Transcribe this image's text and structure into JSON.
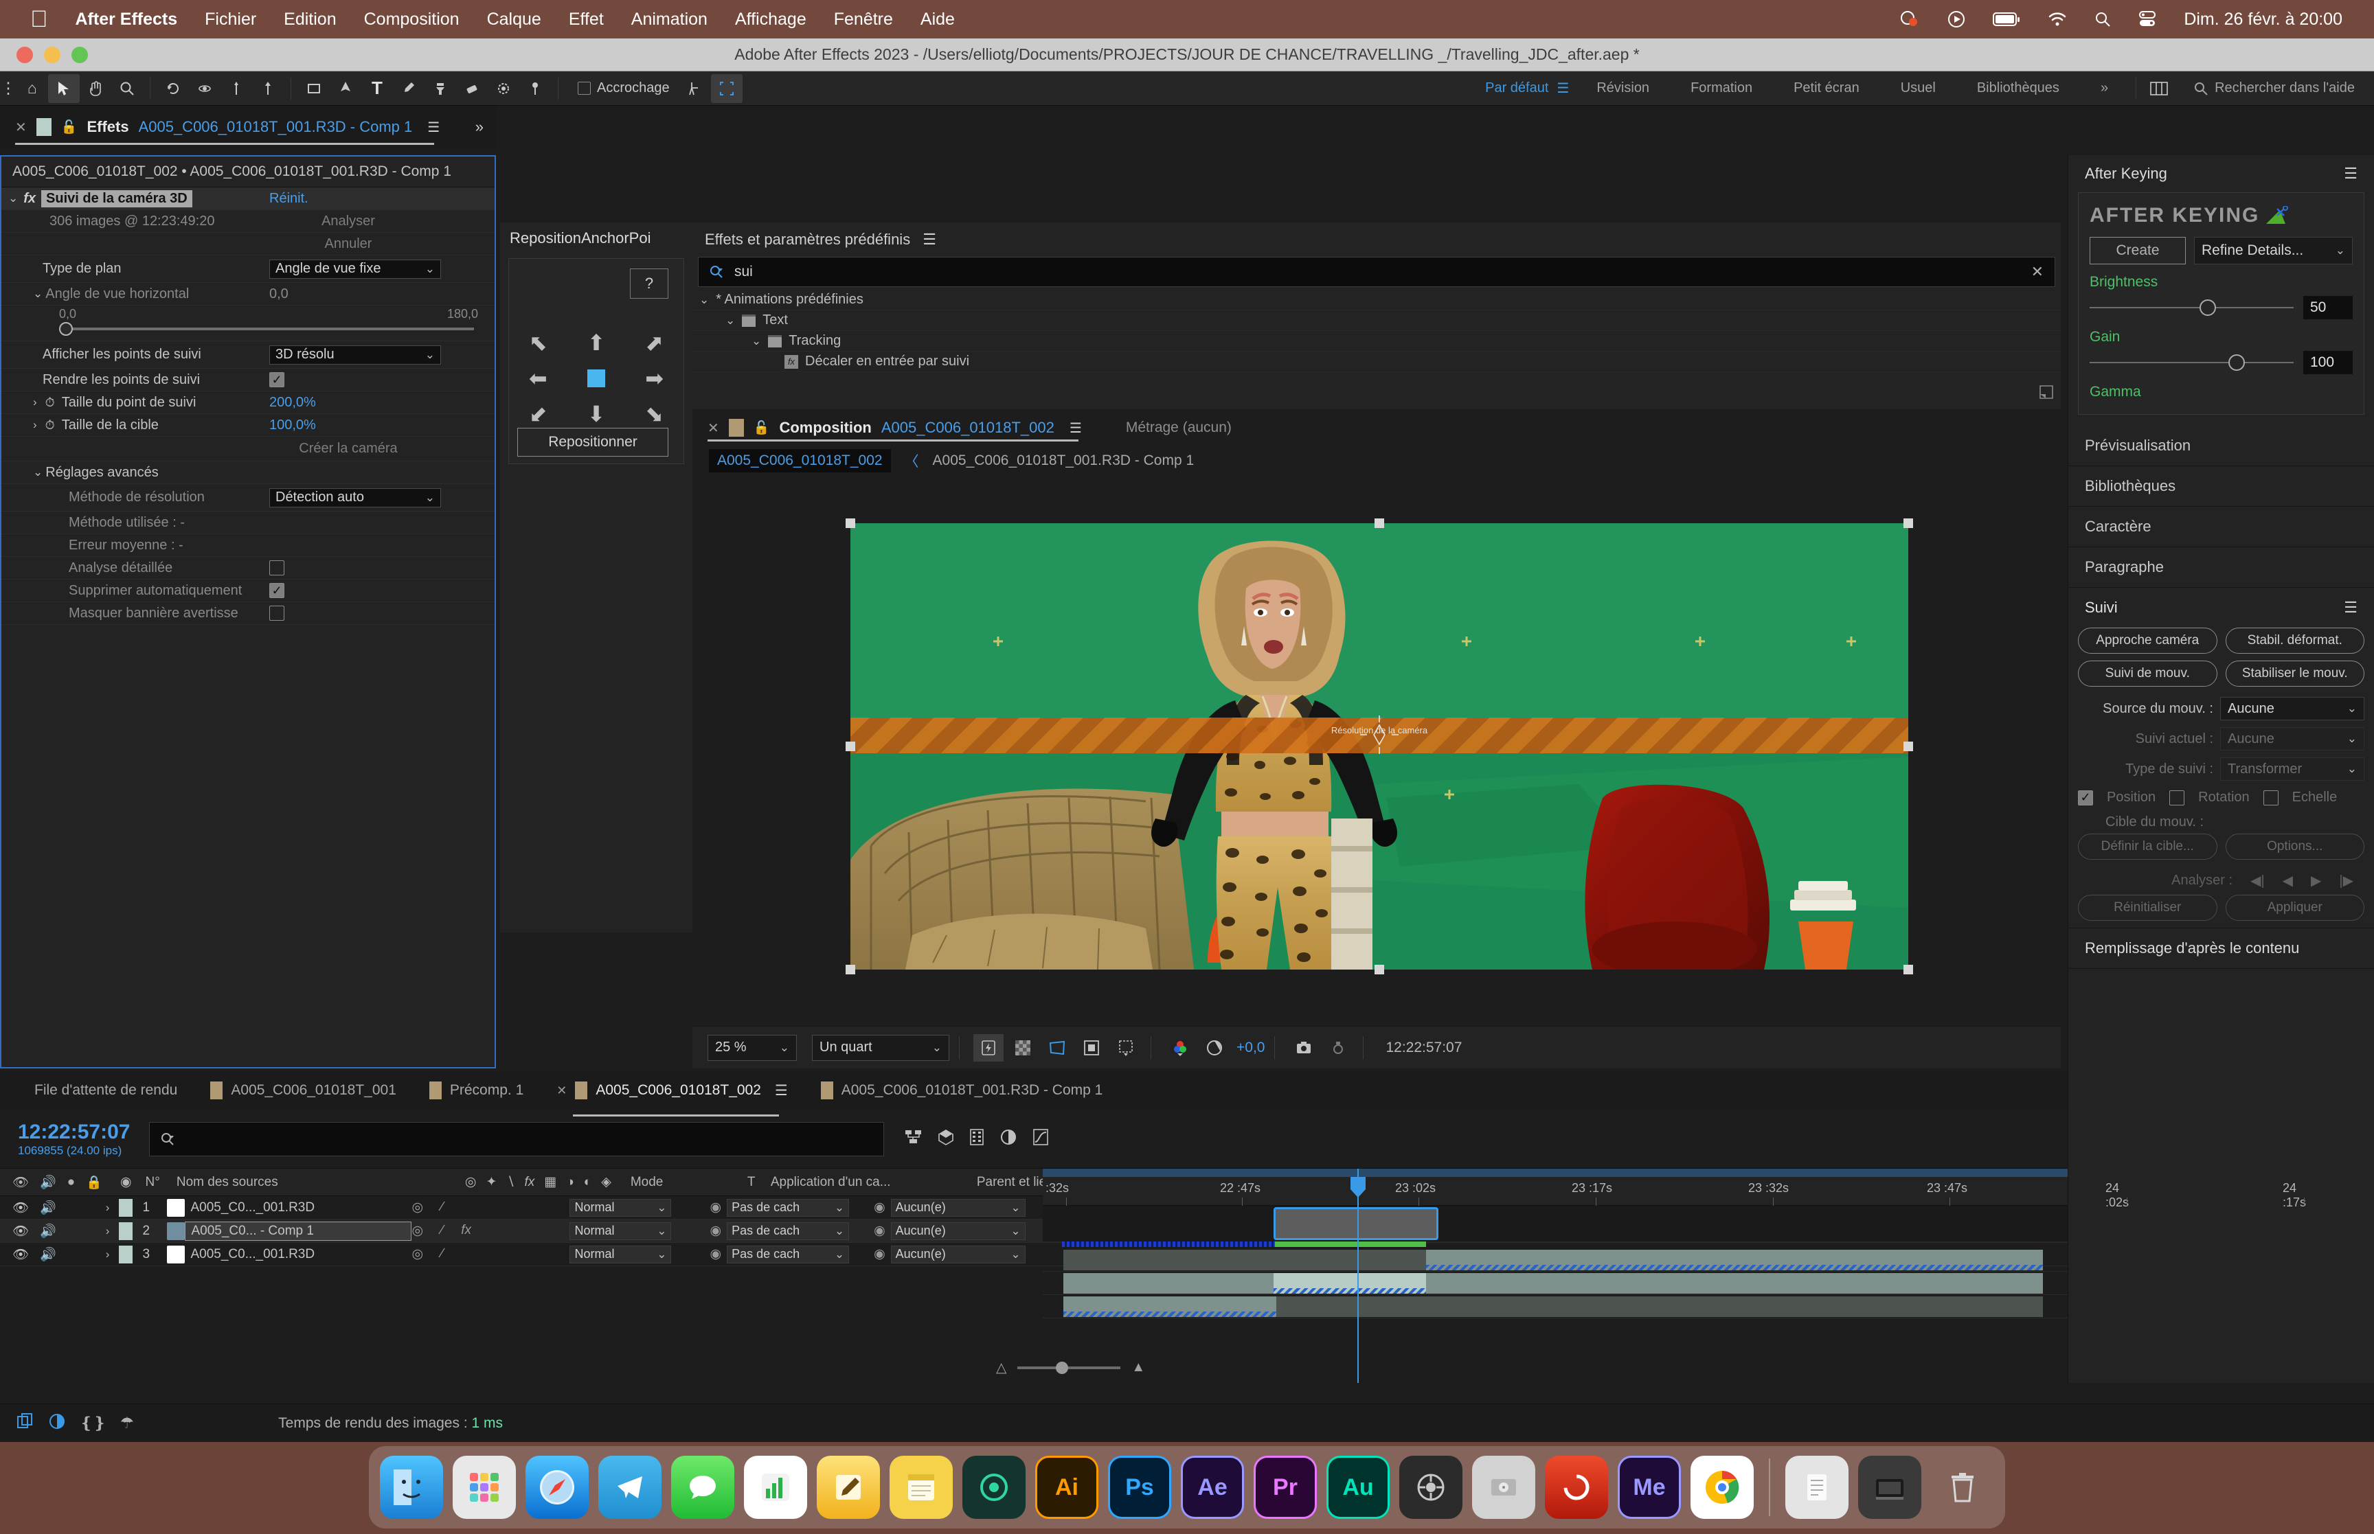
{
  "macbar": {
    "apple_icon": "apple-icon",
    "menus": [
      "After Effects",
      "Fichier",
      "Edition",
      "Composition",
      "Calque",
      "Effet",
      "Animation",
      "Affichage",
      "Fenêtre",
      "Aide"
    ],
    "status_icons": [
      "dropbox-icon",
      "play-circle-icon",
      "battery-icon",
      "wifi-icon",
      "search-icon",
      "control-center-icon"
    ],
    "clock": "Dim. 26 févr. à 20:00"
  },
  "window": {
    "title": "Adobe After Effects 2023 - /Users/elliotg/Documents/PROJECTS/JOUR DE CHANCE/TRAVELLING _/Travelling_JDC_after.aep *"
  },
  "toolbar": {
    "snap_label": "Accrochage",
    "workspaces": [
      {
        "label": "Par défaut",
        "active": true
      },
      {
        "label": "Révision",
        "active": false
      },
      {
        "label": "Formation",
        "active": false
      },
      {
        "label": "Petit écran",
        "active": false
      },
      {
        "label": "Usuel",
        "active": false
      },
      {
        "label": "Bibliothèques",
        "active": false
      }
    ],
    "overflow_label": "»",
    "search_placeholder": "Rechercher dans l'aide"
  },
  "effect_controls": {
    "tab_title": "Effets",
    "tab_subtitle": "A005_C006_01018T_001.R3D - Comp 1",
    "breadcrumb": "A005_C006_01018T_002 • A005_C006_01018T_001.R3D - Comp 1",
    "effect_name": "Suivi de la caméra 3D",
    "reset_label": "Réinit.",
    "frames_label": "306 images @ 12:23:49:20",
    "analyze_label": "Analyser",
    "cancel_label": "Annuler",
    "shot_type_label": "Type de plan",
    "shot_type_value": "Angle de vue fixe",
    "hfov_label": "Angle de vue horizontal",
    "hfov_value": "0,0",
    "hfov_min": "0,0",
    "hfov_max": "180,0",
    "show_points_label": "Afficher les points de suivi",
    "show_points_value": "3D résolu",
    "render_points_label": "Rendre les points de suivi",
    "render_points_checked": true,
    "point_size_label": "Taille du point de suivi",
    "point_size_value": "200,0%",
    "target_size_label": "Taille de la cible",
    "target_size_value": "100,0%",
    "create_camera_label": "Créer la caméra",
    "advanced_label": "Réglages avancés",
    "solve_method_label": "Méthode de résolution",
    "solve_method_value": "Détection auto",
    "used_method_label": "Méthode utilisée : -",
    "avg_error_label": "Erreur moyenne : -",
    "detailed_label": "Analyse détaillée",
    "detailed_checked": false,
    "autodelete_label": "Supprimer automatiquement",
    "autodelete_checked": true,
    "hide_banner_label": "Masquer bannière avertisse",
    "hide_banner_checked": false
  },
  "reposition_panel": {
    "title": "RepositionAnchorPoi",
    "help_label": "?",
    "arrows": [
      "arrow-up-left",
      "arrow-up",
      "arrow-up-right",
      "arrow-left",
      "center-square",
      "arrow-right",
      "arrow-down-left",
      "arrow-down",
      "arrow-down-right"
    ],
    "button_label": "Repositionner"
  },
  "effects_presets": {
    "title": "Effets et paramètres prédéfinis",
    "search_value": "sui",
    "tree": [
      {
        "label": "* Animations prédéfinies",
        "depth": 0,
        "type": "group"
      },
      {
        "label": "Text",
        "depth": 1,
        "type": "folder"
      },
      {
        "label": "Tracking",
        "depth": 2,
        "type": "folder"
      },
      {
        "label": "Décaler en entrée par suivi",
        "depth": 3,
        "type": "preset"
      }
    ]
  },
  "composition": {
    "tab_label": "Composition",
    "tab_name": "A005_C006_01018T_002",
    "footage_label": "Métrage  (aucun)",
    "breadcrumb_active": "A005_C006_01018T_002",
    "breadcrumb_chevron": "〈",
    "breadcrumb_parent": "A005_C006_01018T_001.R3D - Comp 1",
    "canvas_overlay_text": "Résolution de la caméra",
    "bottom": {
      "zoom": "25 %",
      "resolution": "Un quart",
      "exposure": "+0,0",
      "timecode": "12:22:57:07",
      "icons": [
        "fast-preview-icon",
        "transparency-grid-icon",
        "region-of-interest-icon",
        "mask-icon",
        "snapshot-icon",
        "channel-icon",
        "exposure-icon",
        "camera-icon",
        "reset-exposure-icon"
      ]
    }
  },
  "right_sidebar": {
    "panel_title": "After Keying",
    "logo_text": "AFTER KEYING",
    "create_label": "Create",
    "refine_label": "Refine Details...",
    "brightness_label": "Brightness",
    "brightness_value": "50",
    "gain_label": "Gain",
    "gain_value": "100",
    "gamma_label": "Gamma",
    "sections": [
      "Prévisualisation",
      "Bibliothèques",
      "Caractère",
      "Paragraphe"
    ],
    "tracker": {
      "title": "Suivi",
      "buttons": [
        "Approche caméra",
        "Stabil. déformat.",
        "Suivi de mouv.",
        "Stabiliser le mouv."
      ],
      "motion_source_label": "Source du mouv. :",
      "motion_source_value": "Aucune",
      "current_track_label": "Suivi actuel :",
      "current_track_value": "Aucune",
      "track_type_label": "Type de suivi :",
      "track_type_value": "Transformer",
      "position_label": "Position",
      "position_checked": true,
      "rotation_label": "Rotation",
      "rotation_checked": false,
      "scale_label": "Echelle",
      "scale_checked": false,
      "motion_target_label": "Cible du mouv. :",
      "set_target_label": "Définir la cible...",
      "options_label": "Options...",
      "analyse_label": "Analyser :",
      "reset_label": "Réinitialiser",
      "apply_label": "Appliquer"
    },
    "content_aware_label": "Remplissage d'après le contenu",
    "accent_green": "#4fbf6a",
    "accent_blue": "#4a9eea"
  },
  "timeline": {
    "tabs": [
      {
        "label": "File d'attente de rendu",
        "swatch": false,
        "active": false,
        "closable": false
      },
      {
        "label": "A005_C006_01018T_001",
        "swatch": true,
        "active": false,
        "closable": false
      },
      {
        "label": "Précomp. 1",
        "swatch": true,
        "active": false,
        "closable": false
      },
      {
        "label": "A005_C006_01018T_002",
        "swatch": true,
        "active": true,
        "closable": true
      },
      {
        "label": "A005_C006_01018T_001.R3D - Comp 1",
        "swatch": true,
        "active": false,
        "closable": false
      }
    ],
    "timecode": "12:22:57:07",
    "frames": "1069855 (24.00 ips)",
    "search_placeholder": "",
    "columns": [
      "N°",
      "Nom des sources",
      "Mode",
      "T",
      "Application d'un ca...",
      "Parent et lien"
    ],
    "layers": [
      {
        "num": "1",
        "name": "A005_C0..._001.R3D",
        "mode": "Normal",
        "matte": "Pas de cach",
        "parent": "Aucun(e)",
        "selected": false,
        "type": "footage",
        "has_fx": false
      },
      {
        "num": "2",
        "name": "A005_C0... - Comp 1",
        "mode": "Normal",
        "matte": "Pas de cach",
        "parent": "Aucun(e)",
        "selected": true,
        "type": "comp",
        "has_fx": true
      },
      {
        "num": "3",
        "name": "A005_C0..._001.R3D",
        "mode": "Normal",
        "matte": "Pas de cach",
        "parent": "Aucun(e)",
        "selected": false,
        "type": "footage",
        "has_fx": false
      }
    ],
    "ruler_ticks": [
      ":32s",
      "22 :47s",
      "23 :02s",
      "23 :17s",
      "23 :32s",
      "23 :47s",
      "24 :02s",
      "24 :17s"
    ]
  },
  "status_bar": {
    "icons": [
      "render-icon",
      "motion-blur-icon",
      "graph-editor-icon",
      "brainstorm-icon"
    ],
    "text_prefix": "Temps de rendu des images : ",
    "text_value": "1 ms"
  },
  "dock": {
    "apps": [
      {
        "name": "finder",
        "label": "",
        "color": "#2a9df4"
      },
      {
        "name": "launchpad",
        "label": "",
        "color": "#d8d8d8"
      },
      {
        "name": "safari",
        "label": "",
        "color": "#1f8fe0"
      },
      {
        "name": "telegram",
        "label": "",
        "color": "#2f9fd8"
      },
      {
        "name": "messages",
        "label": "",
        "color": "#3ec13a"
      },
      {
        "name": "numbers",
        "label": "",
        "color": "#2fb64a"
      },
      {
        "name": "notes-edit",
        "label": "",
        "color": "#f2b61d"
      },
      {
        "name": "notes",
        "label": "",
        "color": "#f6d14a"
      },
      {
        "name": "webex",
        "label": "",
        "color": "#1fa37a"
      },
      {
        "name": "illustrator",
        "label": "Ai",
        "color": "#ff9a00"
      },
      {
        "name": "photoshop",
        "label": "Ps",
        "color": "#31a8ff"
      },
      {
        "name": "aftereffects",
        "label": "Ae",
        "color": "#9999ff"
      },
      {
        "name": "premiere",
        "label": "Pr",
        "color": "#ea77ff"
      },
      {
        "name": "audition",
        "label": "Au",
        "color": "#00e4bb"
      },
      {
        "name": "davinci",
        "label": "",
        "color": "#3a3a3a"
      },
      {
        "name": "hdd",
        "label": "",
        "color": "#c8c8c8"
      },
      {
        "name": "cinema4d",
        "label": "",
        "color": "#d53a2a"
      },
      {
        "name": "mediaencoder",
        "label": "Me",
        "color": "#9999ff"
      },
      {
        "name": "chrome",
        "label": "",
        "color": "#f1f1f1"
      },
      {
        "name": "documents",
        "label": "",
        "color": "#e0e0e0"
      },
      {
        "name": "downloads",
        "label": "",
        "color": "#3a3a3a"
      },
      {
        "name": "trash",
        "label": "",
        "color": "#b8b8b8"
      }
    ]
  }
}
